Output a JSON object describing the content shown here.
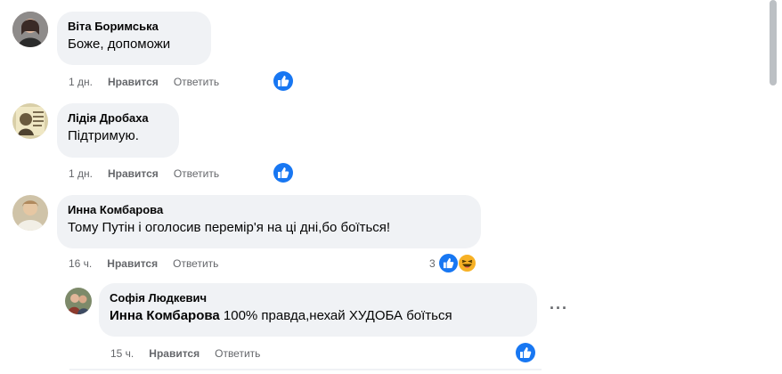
{
  "comments": [
    {
      "author": "Віта Боримська",
      "text": "Боже, допоможи",
      "time": "1 дн.",
      "like_label": "Нравится",
      "reply_label": "Ответить",
      "reactions": [
        "like-icon"
      ]
    },
    {
      "author": "Лідія Дробаха",
      "text": "Підтримую.",
      "time": "1 дн.",
      "like_label": "Нравится",
      "reply_label": "Ответить",
      "reactions": [
        "like-icon"
      ]
    },
    {
      "author": "Инна Комбарова",
      "text": "Тому Путін і оголосив перемір'я на ці дні,бо боїться!",
      "time": "16 ч.",
      "like_label": "Нравится",
      "reply_label": "Ответить",
      "reaction_count": "3",
      "reactions": [
        "like-icon",
        "laugh-icon"
      ]
    }
  ],
  "reply": {
    "author": "Софія Людкевич",
    "mention": "Инна Комбарова",
    "text": " 100% правда,нехай ХУДОБА боїться",
    "time": "15 ч.",
    "like_label": "Нравится",
    "reply_label": "Ответить",
    "reactions": [
      "like-icon"
    ],
    "more_label": "···"
  },
  "colors": {
    "bubble": "#f0f2f5",
    "like_blue": "#1877f2",
    "meta_gray": "#65676b"
  }
}
